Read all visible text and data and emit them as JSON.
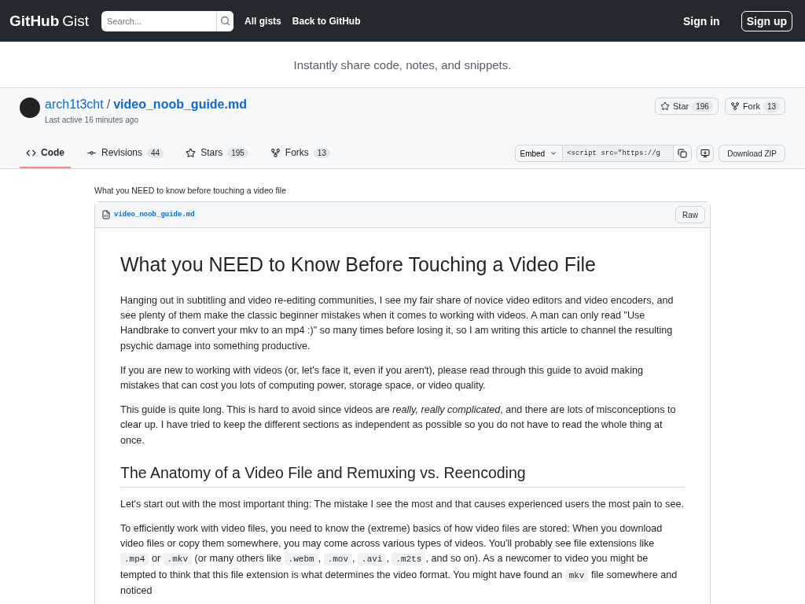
{
  "header": {
    "logo_bold": "GitHub",
    "logo_light": "Gist",
    "search": {
      "placeholder": "Search..."
    },
    "nav": [
      "All gists",
      "Back to GitHub"
    ],
    "sign_in": "Sign in",
    "sign_up": "Sign up"
  },
  "tagline": "Instantly share code, notes, and snippets.",
  "gist": {
    "owner": "arch1t3cht",
    "separator": "/",
    "filename": "video_noob_guide.md",
    "last_active": "Last active 16 minutes ago",
    "actions": [
      {
        "kind": "star",
        "label": "Star",
        "count": "196"
      },
      {
        "kind": "fork",
        "label": "Fork",
        "count": "13"
      }
    ],
    "tabs": [
      {
        "kind": "code",
        "label": "Code",
        "selected": true
      },
      {
        "kind": "revisions",
        "label": "Revisions",
        "count": "44",
        "selected": false
      },
      {
        "kind": "stars",
        "label": "Stars",
        "count": "195",
        "selected": false
      },
      {
        "kind": "forks",
        "label": "Forks",
        "count": "13",
        "selected": false
      }
    ],
    "embed": {
      "label": "Embed",
      "value": "<script src=\"https://g"
    },
    "download": "Download ZIP"
  },
  "description": "What you NEED to know before touching a video file",
  "file": {
    "name": "video_noob_guide.md",
    "raw": "Raw",
    "blocks": [
      {
        "kind": "h1",
        "segments": [
          {
            "kind": "text",
            "text": "What you NEED to Know Before Touching a Video File"
          }
        ]
      },
      {
        "kind": "p",
        "segments": [
          {
            "kind": "text",
            "text": "Hanging out in subtitling and video re-editing communities, I see my fair share of novice video editors and video encoders, and see plenty of them make the classic beginner mistakes when it comes to working with videos. A man can only read \"Use Handbrake to convert your mkv to an mp4 :)\" so many times before losing it, so I am writing this article to channel the resulting psychic damage into something productive."
          }
        ]
      },
      {
        "kind": "p",
        "segments": [
          {
            "kind": "text",
            "text": "If you are new to working with videos (or, let's face it, even if you aren't), please read through this guide to avoid making mistakes that can cost you lots of computing power, storage space, or video quality."
          }
        ]
      },
      {
        "kind": "p",
        "segments": [
          {
            "kind": "text",
            "text": "This guide is quite long. This is hard to avoid since videos are "
          },
          {
            "kind": "em",
            "text": "really, really complicated"
          },
          {
            "kind": "text",
            "text": ", and there are lots of misconceptions to clear up. I have tried to keep the different sections as independent as possible so you do not have to read the whole thing at once."
          }
        ]
      },
      {
        "kind": "h2",
        "segments": [
          {
            "kind": "text",
            "text": "The Anatomy of a Video File and Remuxing vs. Reencoding"
          }
        ]
      },
      {
        "kind": "p",
        "segments": [
          {
            "kind": "text",
            "text": "Let's start out with the most important thing: The mistake I see the most and that causes experienced users the most pain to see."
          }
        ]
      },
      {
        "kind": "p",
        "segments": [
          {
            "kind": "text",
            "text": "To efficiently work with video files, you need to know the (extreme) basics of how video files are stored: When you download video files or copy them somewhere, you may come across various types of videos. You'll probably see file extensions like "
          },
          {
            "kind": "code",
            "text": ".mp4"
          },
          {
            "kind": "text",
            "text": " or "
          },
          {
            "kind": "code",
            "text": ".mkv"
          },
          {
            "kind": "text",
            "text": " (or many others like "
          },
          {
            "kind": "code",
            "text": ".webm"
          },
          {
            "kind": "text",
            "text": ", "
          },
          {
            "kind": "code",
            "text": ".mov"
          },
          {
            "kind": "text",
            "text": ", "
          },
          {
            "kind": "code",
            "text": ".avi"
          },
          {
            "kind": "text",
            "text": ", "
          },
          {
            "kind": "code",
            "text": ".m2ts"
          },
          {
            "kind": "text",
            "text": ", and so on). As a newcomer to video you might be tempted to think that this file extension is what determines the video format. You might have found an "
          },
          {
            "kind": "code",
            "text": "mkv"
          },
          {
            "kind": "text",
            "text": " file somewhere and noticed"
          }
        ]
      }
    ]
  }
}
